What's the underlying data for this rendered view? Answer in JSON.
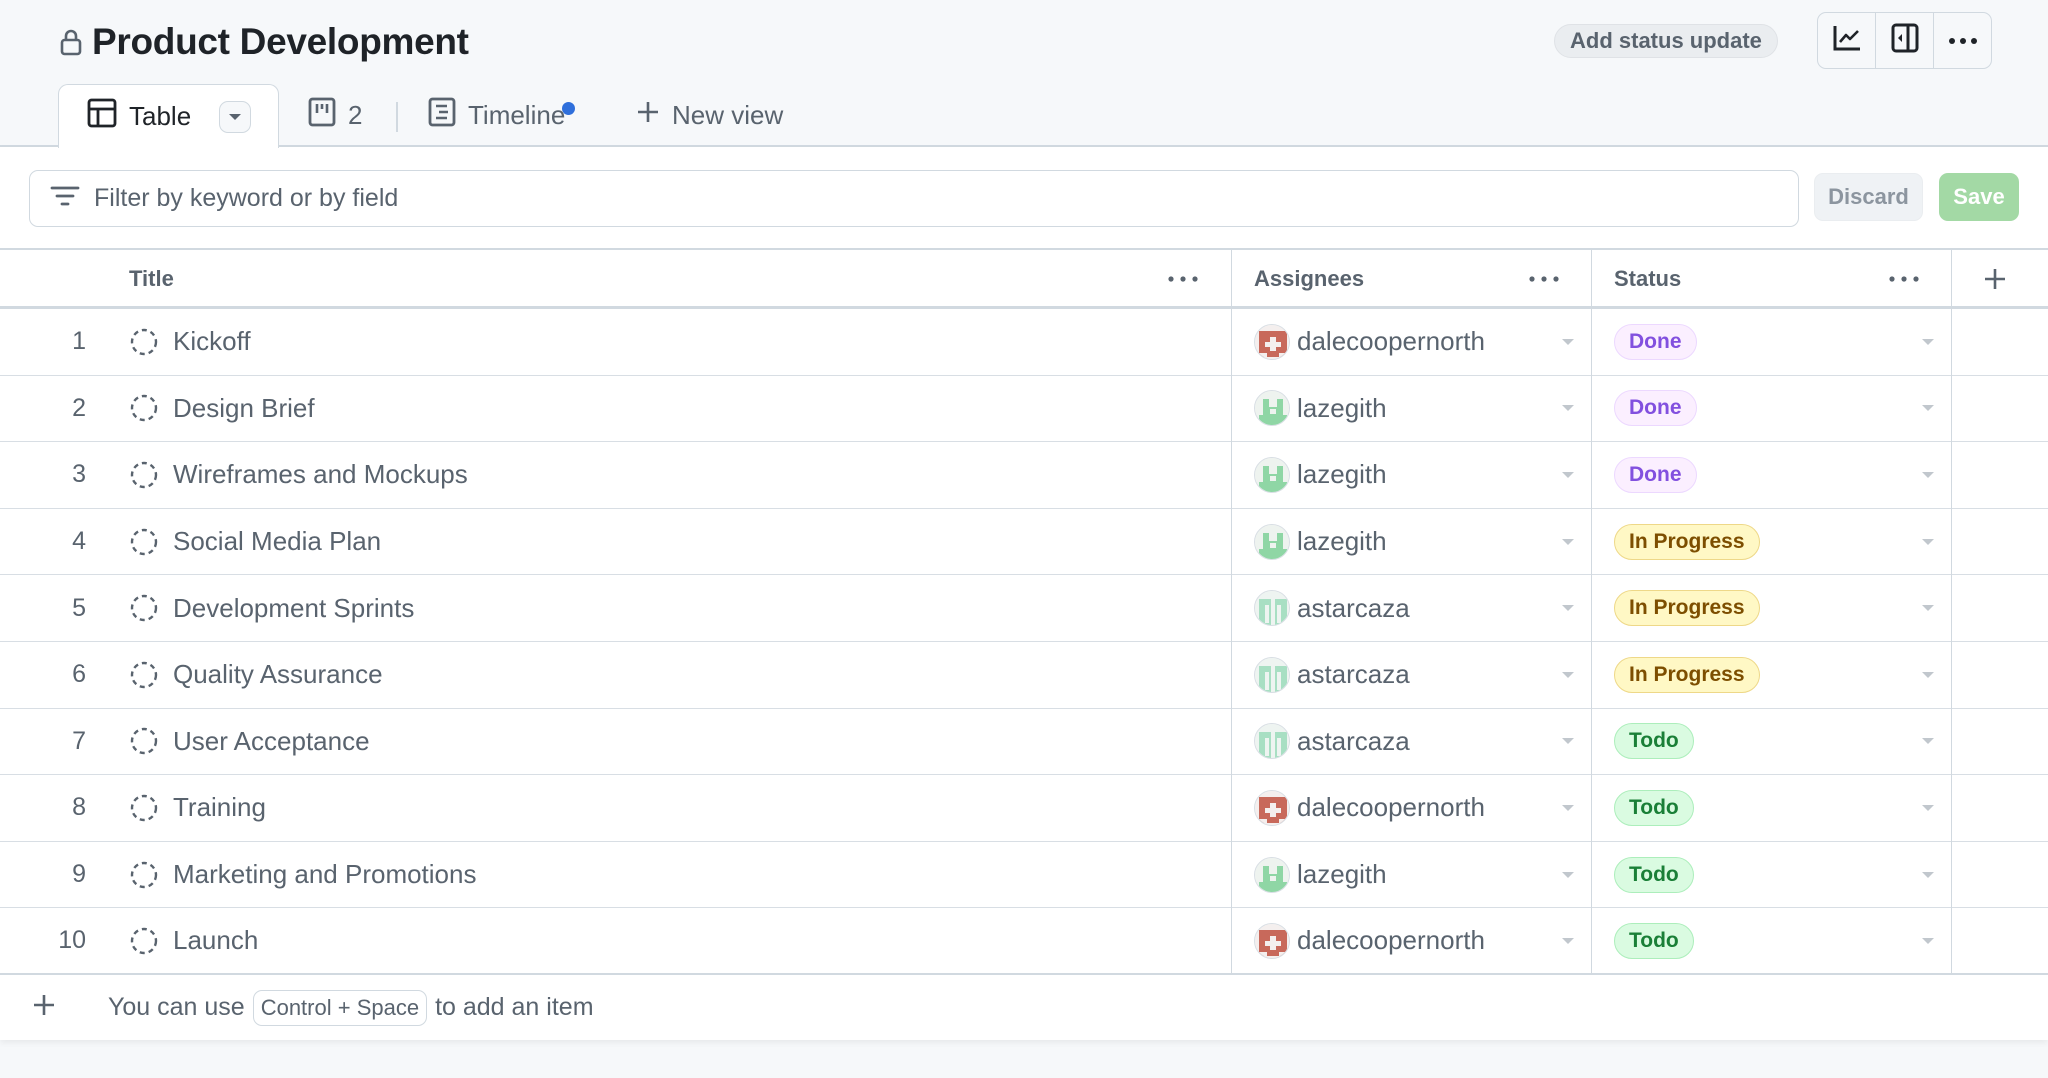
{
  "header": {
    "title": "Product Development",
    "lock_icon": "lock-icon",
    "status_update_label": "Add status update",
    "toolbar_icons": [
      "insights-chart-icon",
      "sidebar-collapse-icon",
      "kebab-horizontal-icon"
    ]
  },
  "tabs": [
    {
      "label": "Table",
      "icon": "table-icon",
      "active": true,
      "has_dropdown": true
    },
    {
      "label": "2",
      "icon": "board-icon",
      "active": false
    },
    {
      "label": "Timeline",
      "icon": "roadmap-icon",
      "active": false,
      "unsaved_dot": true
    },
    {
      "label": "New view",
      "icon": "plus-icon",
      "active": false
    }
  ],
  "filter": {
    "placeholder": "Filter by keyword or by field",
    "value": "",
    "discard_label": "Discard",
    "save_label": "Save"
  },
  "columns": [
    {
      "label": "Title"
    },
    {
      "label": "Assignees"
    },
    {
      "label": "Status"
    }
  ],
  "status_colors": {
    "Done": {
      "bg": "#fbefff",
      "border": "#ecd8ff",
      "text": "#8250df"
    },
    "In Progress": {
      "bg": "#fff8c5",
      "border": "#eed888",
      "text": "#7d4e00"
    },
    "Todo": {
      "bg": "#dafbe1",
      "border": "#aceebb",
      "text": "#1a7f37"
    }
  },
  "users": {
    "dalecoopernorth": {
      "color": "#c8695b",
      "pattern": "cross"
    },
    "lazegith": {
      "color": "#8fd6a5",
      "pattern": "castle"
    },
    "astarcaza": {
      "color": "#a8dfc3",
      "pattern": "pillars"
    }
  },
  "rows": [
    {
      "num": "1",
      "title": "Kickoff",
      "assignee": "dalecoopernorth",
      "status": "Done"
    },
    {
      "num": "2",
      "title": "Design Brief",
      "assignee": "lazegith",
      "status": "Done"
    },
    {
      "num": "3",
      "title": "Wireframes and Mockups",
      "assignee": "lazegith",
      "status": "Done"
    },
    {
      "num": "4",
      "title": "Social Media Plan",
      "assignee": "lazegith",
      "status": "In Progress"
    },
    {
      "num": "5",
      "title": "Development Sprints",
      "assignee": "astarcaza",
      "status": "In Progress"
    },
    {
      "num": "6",
      "title": "Quality Assurance",
      "assignee": "astarcaza",
      "status": "In Progress"
    },
    {
      "num": "7",
      "title": "User Acceptance",
      "assignee": "astarcaza",
      "status": "Todo"
    },
    {
      "num": "8",
      "title": "Training",
      "assignee": "dalecoopernorth",
      "status": "Todo"
    },
    {
      "num": "9",
      "title": "Marketing and Promotions",
      "assignee": "lazegith",
      "status": "Todo"
    },
    {
      "num": "10",
      "title": "Launch",
      "assignee": "dalecoopernorth",
      "status": "Todo"
    }
  ],
  "add_item": {
    "prefix": "You can use",
    "shortcut": "Control + Space",
    "suffix": "to add an item"
  }
}
